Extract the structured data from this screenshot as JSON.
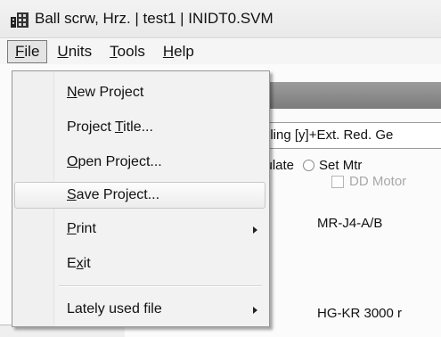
{
  "window": {
    "title": "Ball scrw, Hrz.  | test1 | INIDT0.SVM",
    "icon": "app-grid-icon"
  },
  "menubar": {
    "items": [
      {
        "pre": "",
        "key": "F",
        "post": "ile",
        "open": true
      },
      {
        "pre": "",
        "key": "U",
        "post": "nits",
        "open": false
      },
      {
        "pre": "",
        "key": "T",
        "post": "ools",
        "open": false
      },
      {
        "pre": "",
        "key": "H",
        "post": "elp",
        "open": false
      }
    ]
  },
  "file_menu": {
    "items": [
      {
        "pre": "",
        "key": "N",
        "post": "ew Project",
        "submenu": false,
        "highlighted": false
      },
      {
        "pre": "Project ",
        "key": "T",
        "post": "itle...",
        "submenu": false,
        "highlighted": false
      },
      {
        "pre": "",
        "key": "O",
        "post": "pen Project...",
        "submenu": false,
        "highlighted": false
      },
      {
        "pre": "",
        "key": "S",
        "post": "ave Project...",
        "submenu": false,
        "highlighted": true
      },
      {
        "pre": "",
        "key": "P",
        "post": "rint",
        "submenu": true,
        "highlighted": false
      },
      {
        "pre": "E",
        "key": "x",
        "post": "it",
        "submenu": false,
        "highlighted": false
      },
      {
        "pre": "Lately used file",
        "key": "",
        "post": "",
        "submenu": true,
        "highlighted": false
      }
    ]
  },
  "background": {
    "field_text": "pling [y]+Ext. Red. Ge",
    "calc_text": "culate",
    "set_motor_label": "Set Mtr",
    "dd_motor_label": "DD Motor",
    "amplifier_text": "MR-J4-A/B",
    "motor_text": "HG-KR  3000 r"
  },
  "colors": {
    "menu_bg": "#f2f2f2",
    "highlight_border": "#c8c8c8",
    "gradient_bar": "#8c8c8c",
    "disabled_text": "#a8a8a8"
  }
}
